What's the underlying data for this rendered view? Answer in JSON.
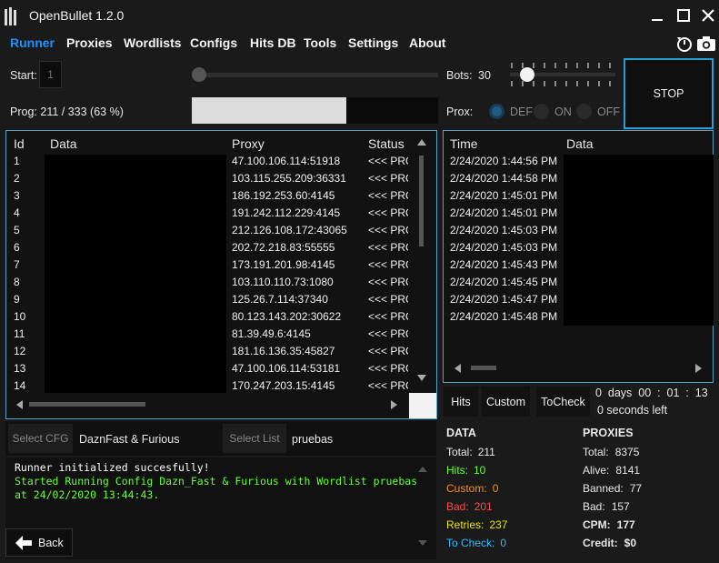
{
  "window": {
    "title": "OpenBullet 1.2.0"
  },
  "nav": [
    "Runner",
    "Proxies",
    "Wordlists",
    "Configs",
    "Hits DB",
    "Tools",
    "Settings",
    "About"
  ],
  "runner": {
    "start_label": "Start:",
    "start_value": "1",
    "bots_label": "Bots:",
    "bots_value": "30",
    "bots_slider_fraction": 0.25,
    "start_slider_fraction": 0.0,
    "prog_label": "Prog:",
    "prog_text": "211 / 333 (63 %)",
    "prog_fraction": 0.63,
    "prox_label": "Prox:",
    "prox_options": [
      "DEF",
      "ON",
      "OFF"
    ],
    "prox_selected": "DEF",
    "stop_label": "STOP"
  },
  "data_grid": {
    "headers": [
      "Id",
      "Data",
      "Proxy",
      "Status"
    ],
    "rows": [
      [
        "1",
        "47.100.106.114:51918",
        "<<< PRO"
      ],
      [
        "2",
        "103.115.255.209:36331",
        "<<< PRO"
      ],
      [
        "3",
        "186.192.253.60:4145",
        "<<< PRO"
      ],
      [
        "4",
        "191.242.112.229:4145",
        "<<< PRO"
      ],
      [
        "5",
        "212.126.108.172:43065",
        "<<< PRO"
      ],
      [
        "6",
        "202.72.218.83:55555",
        "<<< PRO"
      ],
      [
        "7",
        "173.191.201.98:4145",
        "<<< PRO"
      ],
      [
        "8",
        "103.110.110.73:1080",
        "<<< PRO"
      ],
      [
        "9",
        "125.26.7.114:37340",
        "<<< PRO"
      ],
      [
        "10",
        "80.123.143.202:30622",
        "<<< PRO"
      ],
      [
        "11",
        "81.39.49.6:4145",
        "<<< PRO"
      ],
      [
        "12",
        "181.16.136.35:45827",
        "<<< PRO"
      ],
      [
        "13",
        "47.100.106.114:53181",
        "<<< PRO"
      ],
      [
        "14",
        "170.247.203.15:4145",
        "<<< PRO"
      ]
    ]
  },
  "hits_grid": {
    "headers": [
      "Time",
      "Data"
    ],
    "rows": [
      "2/24/2020 1:44:56 PM",
      "2/24/2020 1:44:58 PM",
      "2/24/2020 1:45:01 PM",
      "2/24/2020 1:45:01 PM",
      "2/24/2020 1:45:03 PM",
      "2/24/2020 1:45:03 PM",
      "2/24/2020 1:45:43 PM",
      "2/24/2020 1:45:45 PM",
      "2/24/2020 1:45:47 PM",
      "2/24/2020 1:45:48 PM"
    ]
  },
  "hit_tabs": [
    "Hits",
    "Custom",
    "ToCheck"
  ],
  "timer": {
    "line1": "0  days  00  :  01  :  13",
    "line2": "0 seconds left"
  },
  "config": {
    "select_cfg_label": "Select CFG",
    "cfg_value": "DaznFast & Furious",
    "select_list_label": "Select List",
    "list_value": "pruebas"
  },
  "log": [
    {
      "text": "Runner initialized succesfully!",
      "color": "#ffffff"
    },
    {
      "text": "Started Running Config Dazn_Fast & Furious with Wordlist pruebas",
      "color": "#66ff33"
    },
    {
      "text": "at 24/02/2020 13:44:43.",
      "color": "#66ff33"
    }
  ],
  "back_label": "Back",
  "stats": {
    "data_title": "DATA",
    "data": [
      {
        "label": "Total:",
        "value": "211",
        "color": "#e8e8e8"
      },
      {
        "label": "Hits:",
        "value": "10",
        "color": "#66ff33"
      },
      {
        "label": "Custom:",
        "value": "0",
        "color": "#ff8c1a"
      },
      {
        "label": "Bad:",
        "value": "201",
        "color": "#ff4d4d"
      },
      {
        "label": "Retries:",
        "value": "237",
        "color": "#e6e600"
      },
      {
        "label": "To Check:",
        "value": "0",
        "color": "#33bbff"
      }
    ],
    "proxies_title": "PROXIES",
    "proxies": [
      {
        "label": "Total:",
        "value": "8375"
      },
      {
        "label": "Alive:",
        "value": "8141"
      },
      {
        "label": "Banned:",
        "value": "77"
      },
      {
        "label": "Bad:",
        "value": "157"
      },
      {
        "label": "CPM:",
        "value": "177"
      },
      {
        "label": "Credit:",
        "value": "$0"
      }
    ]
  },
  "colors": {
    "accent": "#1e90ff",
    "border": "#5a9fc4",
    "stop_border": "#2a9fd6"
  },
  "icons": [
    "openbullet-logo-icon",
    "minimize-icon",
    "maximize-icon",
    "close-icon",
    "screenshot-icon",
    "camera-icon",
    "back-arrow-icon"
  ]
}
